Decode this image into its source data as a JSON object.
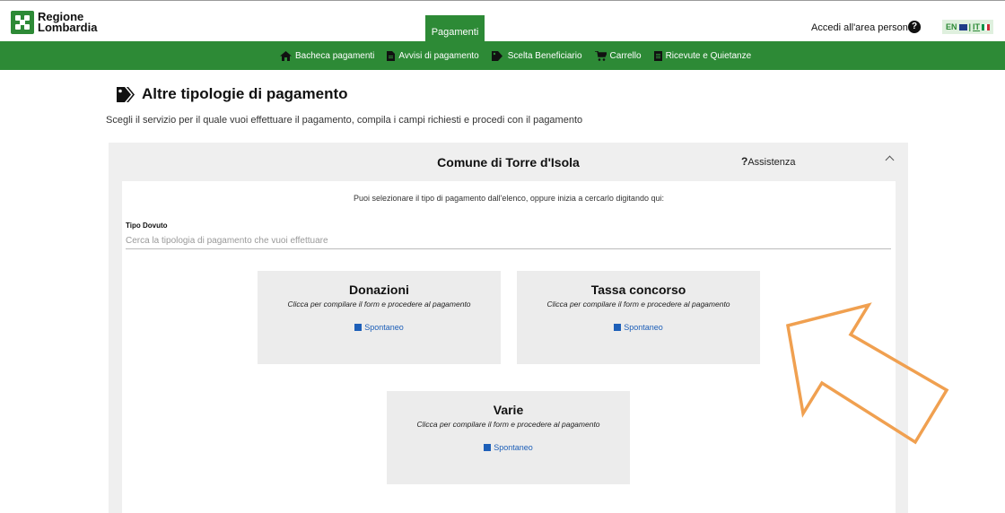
{
  "header": {
    "logo_line1": "Regione",
    "logo_line2": "Lombardia",
    "active_tab": "Pagamenti",
    "login_label": "Accedi all'area personale",
    "help_icon": "question-circle-icon",
    "lang_en": "EN",
    "lang_sep": "|",
    "lang_it": "IT"
  },
  "nav": {
    "items": [
      {
        "label": "Bacheca pagamenti",
        "icon": "home-icon"
      },
      {
        "label": "Avvisi di pagamento",
        "icon": "document-icon"
      },
      {
        "label": "Scelta Beneficiario",
        "icon": "tags-icon"
      },
      {
        "label": "Carrello",
        "icon": "cart-icon"
      },
      {
        "label": "Ricevute e Quietanze",
        "icon": "receipt-icon"
      }
    ]
  },
  "page": {
    "title": "Altre tipologie di pagamento",
    "subtitle": "Scegli il servizio per il quale vuoi effettuare il pagamento, compila i campi richiesti e procedi con il pagamento"
  },
  "panel": {
    "title": "Comune di Torre d'Isola",
    "assist_q": "?",
    "assist_label": "Assistenza",
    "hint": "Puoi selezionare il tipo di pagamento dall'elenco, oppure inizia a cercarlo digitando qui:",
    "field_label": "Tipo Dovuto",
    "search_placeholder": "Cerca la tipologia di pagamento che vuoi effettuare",
    "cards": [
      {
        "title": "Donazioni",
        "desc": "Clicca per compilare il form e procedere al pagamento",
        "link": "Spontaneo"
      },
      {
        "title": "Tassa concorso",
        "desc": "Clicca per compilare il form e procedere al pagamento",
        "link": "Spontaneo"
      },
      {
        "title": "Varie",
        "desc": "Clicca per compilare il form e procedere al pagamento",
        "link": "Spontaneo"
      }
    ]
  },
  "colors": {
    "brand_green": "#2d8a36",
    "link_blue": "#1d5fb8",
    "arrow_orange": "#f0a050"
  }
}
